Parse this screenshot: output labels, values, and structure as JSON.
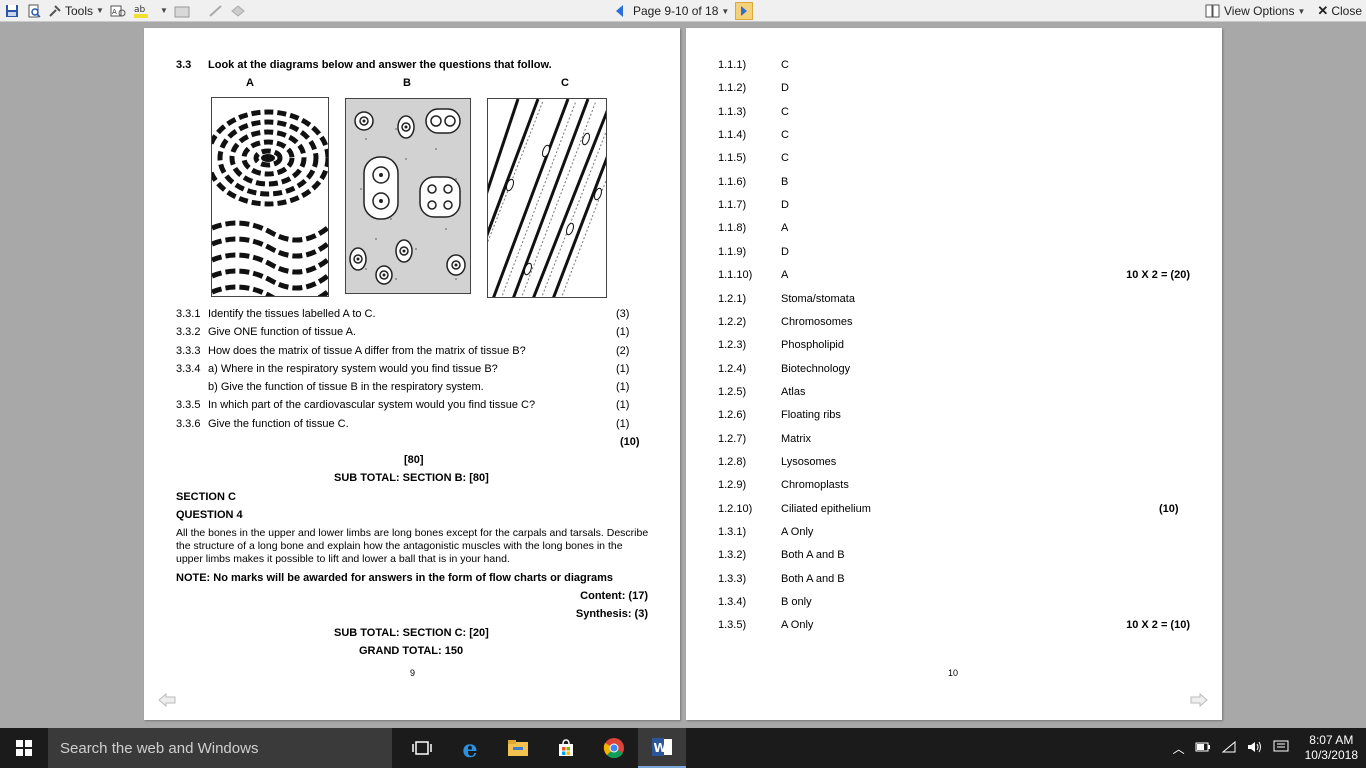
{
  "toolbar": {
    "tools_label": "Tools",
    "page_label": "Page 9-10 of 18",
    "view_options_label": "View Options",
    "close_label": "Close"
  },
  "left_page": {
    "q33": {
      "number": "3.3",
      "text": "Look at the diagrams below and answer the questions that follow.",
      "labels": [
        "A",
        "B",
        "C"
      ]
    },
    "questions": [
      {
        "num": "3.3.1",
        "text": "Identify the tissues labelled A to C.",
        "mark": "(3)"
      },
      {
        "num": "3.3.2",
        "text": "Give ONE function of tissue A.",
        "mark": "(1)"
      },
      {
        "num": "3.3.3",
        "text": "How does the matrix of tissue A differ from the matrix of tissue B?",
        "mark": "(2)"
      },
      {
        "num": "3.3.4",
        "text": "a) Where in the respiratory system would you find tissue B?",
        "mark": "(1)"
      },
      {
        "num": "",
        "text": "b) Give the function of tissue B in the respiratory system.",
        "mark": "(1)"
      },
      {
        "num": "3.3.5",
        "text": "In which part of the cardiovascular system would you find tissue C?",
        "mark": "(1)"
      },
      {
        "num": "3.3.6",
        "text": "Give the function of tissue C.",
        "mark": "(1)"
      }
    ],
    "q_total": "(10)",
    "section_total": "[80]",
    "sub_total_b": "SUB TOTAL:  SECTION B: [80]",
    "section_c": "SECTION C",
    "question4": "QUESTION 4",
    "q4_text": [
      "All the bones in the upper and lower limbs are long bones except for the carpals and tarsals. Describe",
      "the structure of a long bone and explain how the antagonistic muscles with the long bones in the",
      "upper limbs makes it possible to lift and lower a ball that is in your hand."
    ],
    "note": "NOTE: No marks will be awarded for answers in the form of flow charts or diagrams",
    "content": "Content: (17)",
    "synthesis": "Synthesis: (3)",
    "sub_total_c": "SUB TOTAL:  SECTION C: [20]",
    "grand_total": "GRAND TOTAL: 150",
    "page_number": "9"
  },
  "right_page": {
    "answers": [
      {
        "num": "1.1.1)",
        "ans": "C",
        "mark": ""
      },
      {
        "num": "1.1.2)",
        "ans": "D",
        "mark": ""
      },
      {
        "num": "1.1.3)",
        "ans": "C",
        "mark": ""
      },
      {
        "num": "1.1.4)",
        "ans": "C",
        "mark": ""
      },
      {
        "num": "1.1.5)",
        "ans": "C",
        "mark": ""
      },
      {
        "num": "1.1.6)",
        "ans": "B",
        "mark": ""
      },
      {
        "num": "1.1.7)",
        "ans": "D",
        "mark": ""
      },
      {
        "num": "1.1.8)",
        "ans": "A",
        "mark": ""
      },
      {
        "num": "1.1.9)",
        "ans": "D",
        "mark": ""
      },
      {
        "num": "1.1.10)",
        "ans": "A",
        "mark": "10 X 2 = (20)"
      },
      {
        "num": "1.2.1)",
        "ans": "Stoma/stomata",
        "mark": ""
      },
      {
        "num": "1.2.2)",
        "ans": "Chromosomes",
        "mark": ""
      },
      {
        "num": "1.2.3)",
        "ans": "Phospholipid",
        "mark": ""
      },
      {
        "num": "1.2.4)",
        "ans": "Biotechnology",
        "mark": ""
      },
      {
        "num": "1.2.5)",
        "ans": "Atlas",
        "mark": ""
      },
      {
        "num": "1.2.6)",
        "ans": "Floating ribs",
        "mark": ""
      },
      {
        "num": "1.2.7)",
        "ans": "Matrix",
        "mark": ""
      },
      {
        "num": "1.2.8)",
        "ans": "Lysosomes",
        "mark": ""
      },
      {
        "num": "1.2.9)",
        "ans": "Chromoplasts",
        "mark": ""
      },
      {
        "num": "1.2.10)",
        "ans": "Ciliated epithelium",
        "mark": "(10)"
      },
      {
        "num": "1.3.1)",
        "ans": "A Only",
        "mark": ""
      },
      {
        "num": "1.3.2)",
        "ans": "Both A and B",
        "mark": ""
      },
      {
        "num": "1.3.3)",
        "ans": "Both A and B",
        "mark": ""
      },
      {
        "num": "1.3.4)",
        "ans": "B only",
        "mark": ""
      },
      {
        "num": "1.3.5)",
        "ans": "A Only",
        "mark": "10 X 2 = (10)"
      }
    ],
    "page_number": "10"
  },
  "taskbar": {
    "search_placeholder": "Search the web and Windows",
    "time": "8:07 AM",
    "date": "10/3/2018"
  },
  "colors": {
    "accent_blue": "#2c6fd6",
    "taskbar": "#1b1b1b",
    "search_box": "#3a3a3a"
  }
}
